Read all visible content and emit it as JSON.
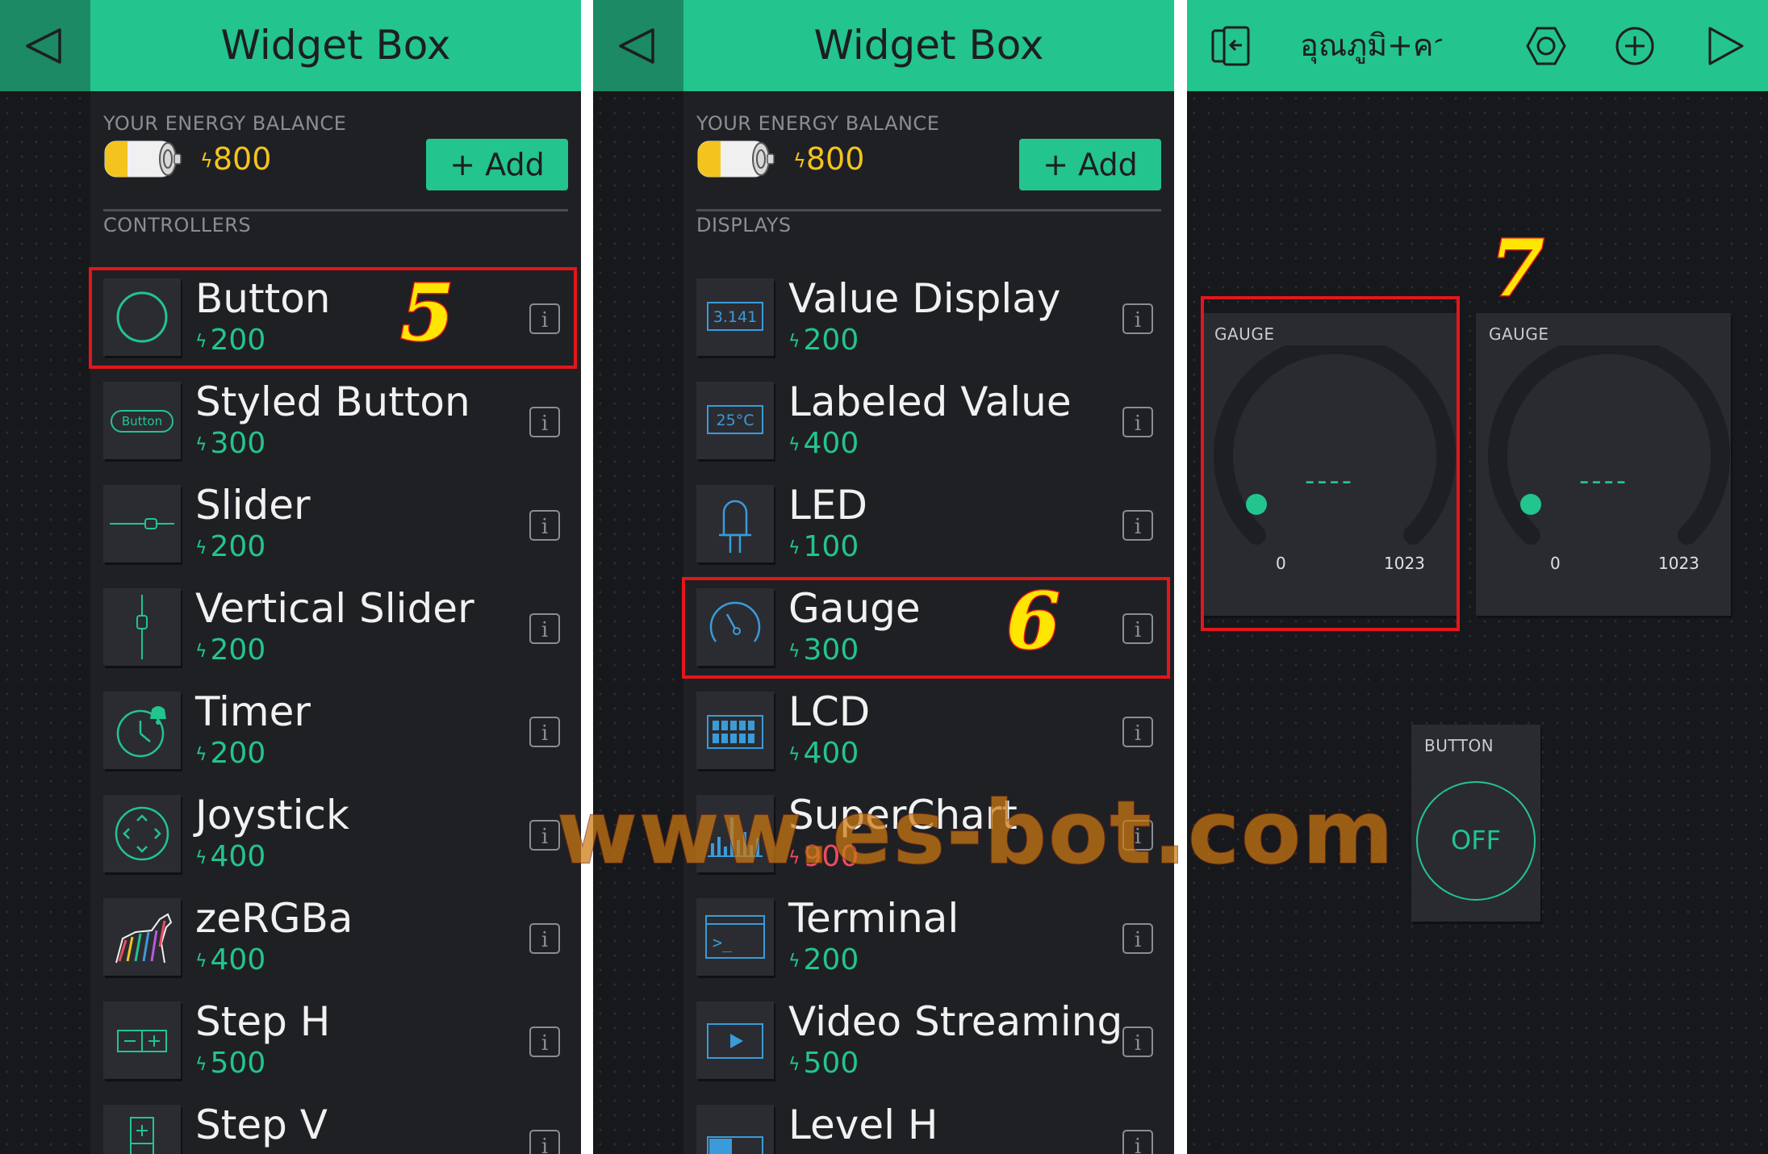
{
  "colors": {
    "accent": "#23c48e",
    "header_dark": "#1c8a64",
    "energy": "#f4c41e",
    "alert": "#ec4c63",
    "highlight": "#e3161b"
  },
  "left_panel": {
    "title": "Widget Box",
    "energy_label": "YOUR ENERGY BALANCE",
    "energy_value": "800",
    "add_label": "+ Add",
    "section": "CONTROLLERS",
    "items": [
      {
        "name": "Button",
        "price": "200",
        "icon": "button-circle-icon"
      },
      {
        "name": "Styled Button",
        "price": "300",
        "icon": "styled-button-icon",
        "icon_text": "Button"
      },
      {
        "name": "Slider",
        "price": "200",
        "icon": "slider-icon"
      },
      {
        "name": "Vertical Slider",
        "price": "200",
        "icon": "vertical-slider-icon"
      },
      {
        "name": "Timer",
        "price": "200",
        "icon": "timer-icon"
      },
      {
        "name": "Joystick",
        "price": "400",
        "icon": "joystick-icon"
      },
      {
        "name": "zeRGBa",
        "price": "400",
        "icon": "zebra-icon"
      },
      {
        "name": "Step H",
        "price": "500",
        "icon": "step-h-icon"
      },
      {
        "name": "Step V",
        "price": "",
        "icon": "step-v-icon"
      }
    ],
    "step_number": "5"
  },
  "middle_panel": {
    "title": "Widget Box",
    "energy_label": "YOUR ENERGY BALANCE",
    "energy_value": "800",
    "add_label": "+ Add",
    "section": "DISPLAYS",
    "items": [
      {
        "name": "Value Display",
        "price": "200",
        "icon": "value-display-icon",
        "icon_text": "3.141"
      },
      {
        "name": "Labeled Value",
        "price": "400",
        "icon": "labeled-value-icon",
        "icon_text": "25°C"
      },
      {
        "name": "LED",
        "price": "100",
        "icon": "led-icon"
      },
      {
        "name": "Gauge",
        "price": "300",
        "icon": "gauge-icon"
      },
      {
        "name": "LCD",
        "price": "400",
        "icon": "lcd-icon"
      },
      {
        "name": "SuperChart",
        "price": "900",
        "icon": "superchart-icon"
      },
      {
        "name": "Terminal",
        "price": "200",
        "icon": "terminal-icon",
        "icon_text": ">_"
      },
      {
        "name": "Video Streaming",
        "price": "500",
        "icon": "video-icon"
      },
      {
        "name": "Level H",
        "price": "",
        "icon": "level-h-icon"
      }
    ],
    "step_number": "6"
  },
  "right_panel": {
    "project_name": "อุณภูมิ+ความชื้น",
    "widgets": {
      "gauge1": {
        "label": "GAUGE",
        "value": "----",
        "min": "0",
        "max": "1023"
      },
      "gauge2": {
        "label": "GAUGE",
        "value": "----",
        "min": "0",
        "max": "1023"
      },
      "button": {
        "label": "BUTTON",
        "state": "OFF"
      }
    },
    "step_number": "7"
  },
  "watermark": "www.es-bot.com",
  "info_glyph": "i"
}
